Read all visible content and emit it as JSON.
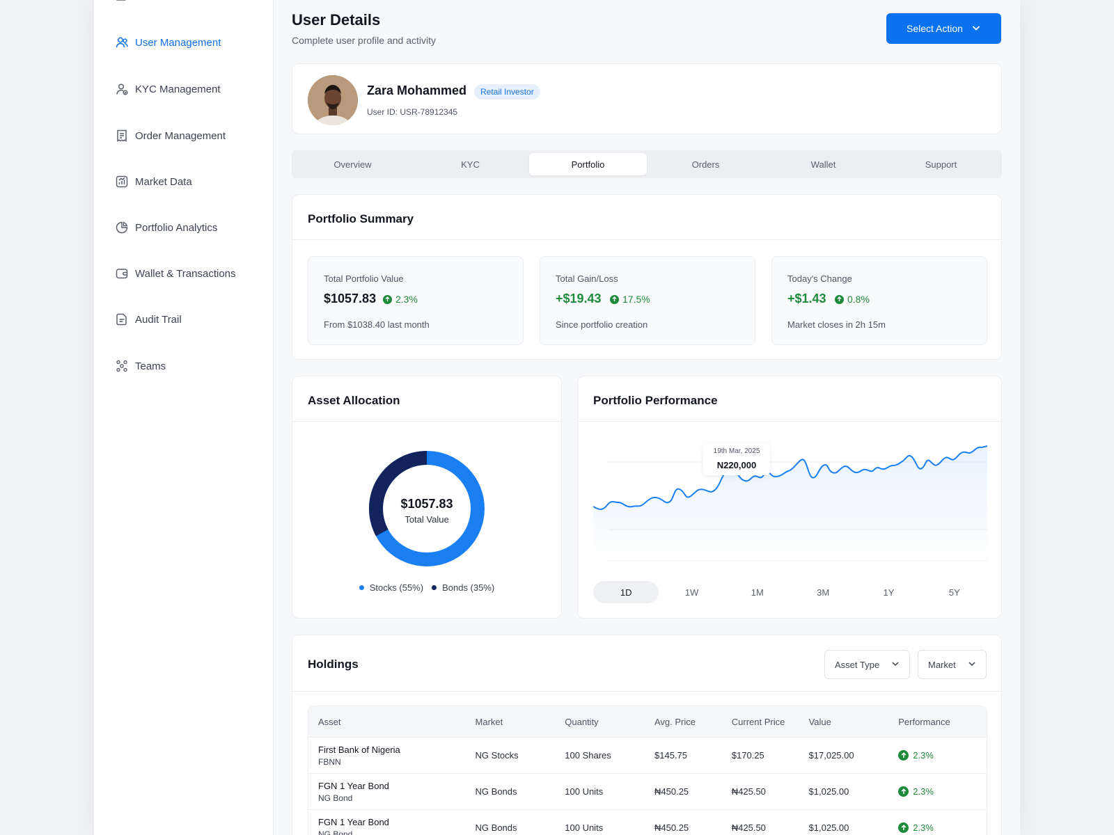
{
  "sidebar": {
    "items": [
      {
        "label": "User Management",
        "icon": "users-icon",
        "active": true
      },
      {
        "label": "KYC Management",
        "icon": "user-check-icon"
      },
      {
        "label": "Order Management",
        "icon": "receipt-icon"
      },
      {
        "label": "Market Data",
        "icon": "chart-icon"
      },
      {
        "label": "Portfolio Analytics",
        "icon": "pie-icon"
      },
      {
        "label": "Wallet & Transactions",
        "icon": "wallet-icon"
      },
      {
        "label": "Audit Trail",
        "icon": "document-icon"
      },
      {
        "label": "Teams",
        "icon": "team-icon"
      }
    ]
  },
  "header": {
    "title": "User Details",
    "subtitle": "Complete user profile and activity",
    "action_label": "Select Action"
  },
  "profile": {
    "name": "Zara Mohammed",
    "badge": "Retail Investor",
    "user_id": "User ID: USR-78912345"
  },
  "tabs": [
    "Overview",
    "KYC",
    "Portfolio",
    "Orders",
    "Wallet",
    "Support"
  ],
  "active_tab": "Portfolio",
  "summary": {
    "title": "Portfolio Summary",
    "cards": [
      {
        "label": "Total Portfolio Value",
        "value": "$1057.83",
        "change": "2.3%",
        "note": "From $1038.40 last month"
      },
      {
        "label": "Total Gain/Loss",
        "value": "+$19.43",
        "change": "17.5%",
        "note": "Since portfolio creation"
      },
      {
        "label": "Today's Change",
        "value": "+$1.43",
        "change": "0.8%",
        "note": "Market closes in 2h 15m"
      }
    ]
  },
  "allocation": {
    "title": "Asset Allocation",
    "center_value": "$1057.83",
    "center_label": "Total Value",
    "legend": [
      {
        "label": "Stocks (55%)",
        "color": "#1a7ff2"
      },
      {
        "label": "Bonds (35%)",
        "color": "#13235c"
      }
    ]
  },
  "performance": {
    "title": "Portfolio Performance",
    "tooltip_date": "19th Mar, 2025",
    "tooltip_value": "N220,000",
    "ranges": [
      "1D",
      "1W",
      "1M",
      "3M",
      "1Y",
      "5Y"
    ],
    "active_range": "1D"
  },
  "holdings": {
    "title": "Holdings",
    "filter_asset_type": "Asset Type",
    "filter_market": "Market",
    "columns": [
      "Asset",
      "Market",
      "Quantity",
      "Avg. Price",
      "Current Price",
      "Value",
      "Performance"
    ],
    "rows": [
      {
        "name": "First Bank of Nigeria",
        "code": "FBNN",
        "market": "NG Stocks",
        "quantity": "100 Shares",
        "avg": "$145.75",
        "current": "$170.25",
        "value": "$17,025.00",
        "perf": "2.3%"
      },
      {
        "name": "FGN 1 Year Bond",
        "code": "NG Bond",
        "market": "NG Bonds",
        "quantity": "100 Units",
        "avg": "₦450.25",
        "current": "₦425.50",
        "value": "$1,025.00",
        "perf": "2.3%"
      },
      {
        "name": "FGN 1 Year Bond",
        "code": "NG Bond",
        "market": "NG Bonds",
        "quantity": "100 Units",
        "avg": "₦450.25",
        "current": "₦425.50",
        "value": "$1,025.00",
        "perf": "2.3%"
      }
    ]
  },
  "colors": {
    "accent": "#0a72ee",
    "positive": "#1f8a3b",
    "donut_primary": "#1a7ff2",
    "donut_secondary": "#13235c"
  }
}
